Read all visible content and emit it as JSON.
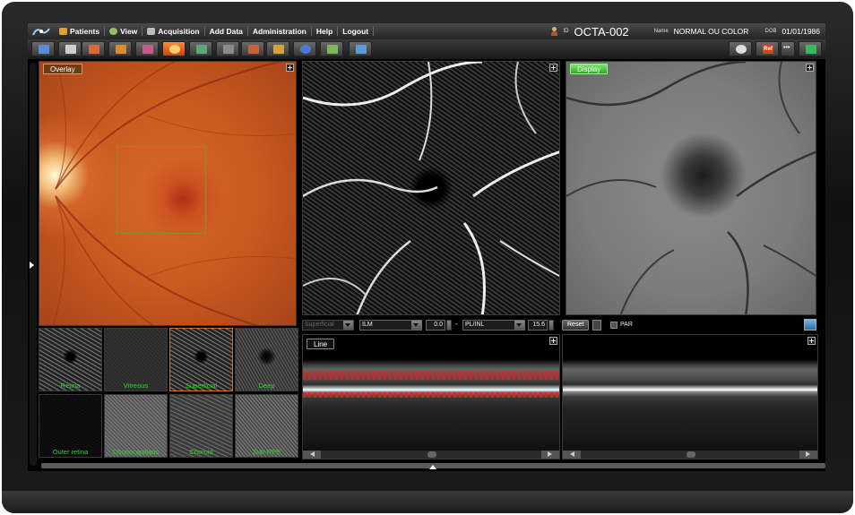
{
  "menu": {
    "items": [
      {
        "label": "Patients",
        "icon": "patients-icon",
        "color": "#e0a030"
      },
      {
        "label": "View",
        "icon": "eye-icon",
        "color": "#9bbf60"
      },
      {
        "label": "Acquisition",
        "icon": "camera-icon",
        "color": "#bbbbbb"
      },
      {
        "label": "Add Data",
        "icon": "",
        "color": ""
      },
      {
        "label": "Administration",
        "icon": "",
        "color": ""
      },
      {
        "label": "Help",
        "icon": "",
        "color": ""
      },
      {
        "label": "Logout",
        "icon": "",
        "color": ""
      }
    ]
  },
  "patient": {
    "id_label": "ID",
    "id": "OCTA-002",
    "name_label": "Name",
    "name": "NORMAL OU COLOR",
    "dob_label": "DOB",
    "dob": "01/01/1986"
  },
  "toolbar": {
    "left_tools": [
      "save-icon",
      "print-icon",
      "export-icon",
      "layout-icon",
      "grid-icon",
      "angio-icon",
      "report-icon",
      "compare-icon",
      "bscan-icon",
      "analysis-icon",
      "globe-icon",
      "image-icon",
      "document-icon"
    ],
    "active_tool": "angio-icon",
    "right_tools": [
      "eye-icon",
      "ref-icon",
      "more-icon",
      "chart-icon"
    ],
    "ref_label": "Ref",
    "more_label": "•••"
  },
  "fundus_panel": {
    "label": "Overlay"
  },
  "enface_panel": {
    "label": "Display"
  },
  "thumbnails": [
    {
      "label": "Retina",
      "style": "t-retina",
      "selected": false
    },
    {
      "label": "Vitreous",
      "style": "t-noise",
      "selected": false
    },
    {
      "label": "Superficial",
      "style": "t-retina",
      "selected": true
    },
    {
      "label": "Deep",
      "style": "t-deep",
      "selected": false
    },
    {
      "label": "Outer retina",
      "style": "t-outer",
      "selected": false
    },
    {
      "label": "Choriocapillaris",
      "style": "t-cc",
      "selected": false
    },
    {
      "label": "Choroid",
      "style": "t-choroid",
      "selected": false
    },
    {
      "label": "Sub-RPE",
      "style": "t-rpe",
      "selected": false
    }
  ],
  "controls": {
    "slab": "Superficial",
    "upper_layer": "ILM",
    "upper_offset": "0.0",
    "separator": "-",
    "lower_layer": "PL/INL",
    "lower_offset": "15.6",
    "reset_label": "Reset",
    "par_label": "PAR"
  },
  "bscan_panel": {
    "label": "Line"
  }
}
